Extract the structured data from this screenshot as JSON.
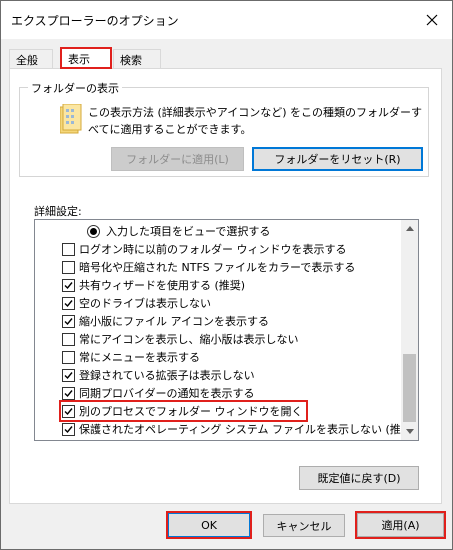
{
  "window": {
    "title": "エクスプローラーのオプション",
    "close_icon": "close-icon"
  },
  "tabs": [
    {
      "label": "全般",
      "active": false
    },
    {
      "label": "表示",
      "active": true
    },
    {
      "label": "検索",
      "active": false
    }
  ],
  "folder_view": {
    "legend": "フォルダーの表示",
    "description": "この表示方法 (詳細表示やアイコンなど) をこの種類のフォルダーすべてに適用することができます。",
    "apply_button": "フォルダーに適用(L)",
    "apply_button_enabled": false,
    "reset_button": "フォルダーをリセット(R)"
  },
  "advanced": {
    "label": "詳細設定:",
    "items": [
      {
        "type": "radio",
        "label": "入力した項目をビューで選択する",
        "checked": true
      },
      {
        "type": "checkbox",
        "label": "ログオン時に以前のフォルダー ウィンドウを表示する",
        "checked": false
      },
      {
        "type": "checkbox",
        "label": "暗号化や圧縮された NTFS ファイルをカラーで表示する",
        "checked": false
      },
      {
        "type": "checkbox",
        "label": "共有ウィザードを使用する (推奨)",
        "checked": true
      },
      {
        "type": "checkbox",
        "label": "空のドライブは表示しない",
        "checked": true
      },
      {
        "type": "checkbox",
        "label": "縮小版にファイル アイコンを表示する",
        "checked": true
      },
      {
        "type": "checkbox",
        "label": "常にアイコンを表示し、縮小版は表示しない",
        "checked": false
      },
      {
        "type": "checkbox",
        "label": "常にメニューを表示する",
        "checked": false
      },
      {
        "type": "checkbox",
        "label": "登録されている拡張子は表示しない",
        "checked": true
      },
      {
        "type": "checkbox",
        "label": "同期プロバイダーの通知を表示する",
        "checked": true
      },
      {
        "type": "checkbox",
        "label": "別のプロセスでフォルダー ウィンドウを開く",
        "checked": true,
        "highlighted": true
      },
      {
        "type": "checkbox",
        "label": "保護されたオペレーティング システム ファイルを表示しない (推奨)",
        "checked": true
      }
    ]
  },
  "restore_defaults_button": "既定値に戻す(D)",
  "footer": {
    "ok": "OK",
    "cancel": "キャンセル",
    "apply": "適用(A)"
  },
  "colors": {
    "highlight_red": "#e0201c",
    "focus_blue": "#0078d7"
  }
}
